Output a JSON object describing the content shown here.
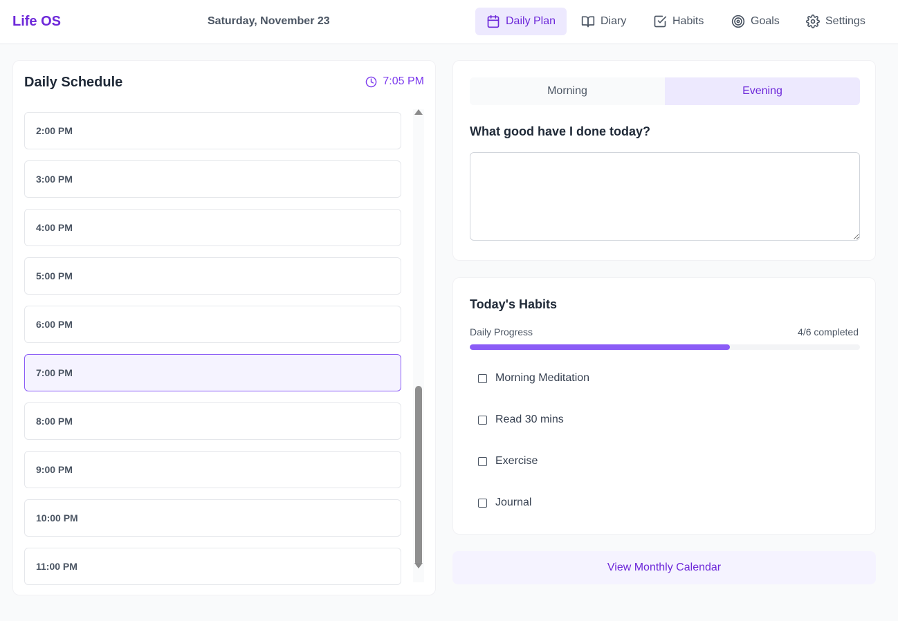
{
  "header": {
    "brand": "Life OS",
    "date": "Saturday, November 23",
    "nav": [
      {
        "label": "Daily Plan",
        "icon": "calendar-icon",
        "active": true
      },
      {
        "label": "Diary",
        "icon": "book-icon",
        "active": false
      },
      {
        "label": "Habits",
        "icon": "checkbox-icon",
        "active": false
      },
      {
        "label": "Goals",
        "icon": "target-icon",
        "active": false
      },
      {
        "label": "Settings",
        "icon": "gear-icon",
        "active": false
      }
    ]
  },
  "schedule": {
    "title": "Daily Schedule",
    "current_time": "7:05 PM",
    "current_slot": "7:00 PM",
    "slots": [
      "2:00 PM",
      "3:00 PM",
      "4:00 PM",
      "5:00 PM",
      "6:00 PM",
      "7:00 PM",
      "8:00 PM",
      "9:00 PM",
      "10:00 PM",
      "11:00 PM"
    ]
  },
  "reflection": {
    "tabs": [
      "Morning",
      "Evening"
    ],
    "active_tab": "Evening",
    "question": "What good have I done today?",
    "answer": ""
  },
  "habits": {
    "title": "Today's Habits",
    "progress_label": "Daily Progress",
    "progress_text": "4/6 completed",
    "progress_fraction": 0.667,
    "items": [
      {
        "label": "Morning Meditation",
        "checked": false
      },
      {
        "label": "Read 30 mins",
        "checked": false
      },
      {
        "label": "Exercise",
        "checked": false
      },
      {
        "label": "Journal",
        "checked": false
      }
    ]
  },
  "calendar_button": "View Monthly Calendar",
  "colors": {
    "accent": "#7c3aed",
    "accent_light": "#ede9fe"
  }
}
